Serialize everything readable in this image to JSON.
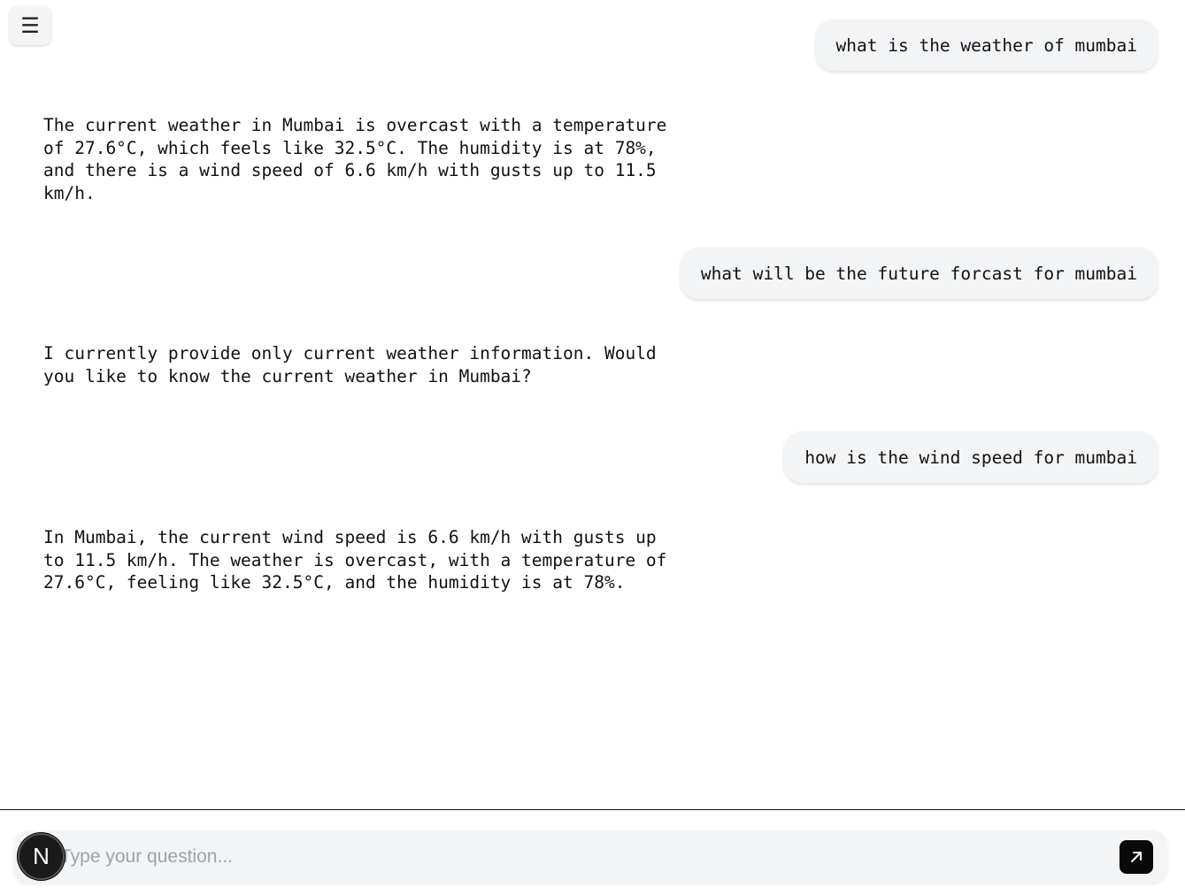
{
  "menu": {
    "icon": "hamburger-icon",
    "glyph": "☰"
  },
  "messages": [
    {
      "role": "user",
      "text": "what is the weather of mumbai"
    },
    {
      "role": "assistant",
      "text": "The current weather in Mumbai is overcast with a temperature\nof 27.6°C, which feels like 32.5°C. The humidity is at 78%,\nand there is a wind speed of 6.6 km/h with gusts up to 11.5\nkm/h."
    },
    {
      "role": "user",
      "text": "what will be the future forcast for mumbai"
    },
    {
      "role": "assistant",
      "text": "I currently provide only current weather information. Would\nyou like to know the current weather in Mumbai?"
    },
    {
      "role": "user",
      "text": "how is the wind speed for mumbai"
    },
    {
      "role": "assistant",
      "text": "In Mumbai, the current wind speed is 6.6 km/h with gusts up\nto 11.5 km/h. The weather is overcast, with a temperature of\n27.6°C, feeling like 32.5°C, and the humidity is at 78%."
    }
  ],
  "composer": {
    "placeholder": "Type your question...",
    "send_icon": "arrow-up-right-icon"
  },
  "badge": {
    "letter": "N"
  }
}
